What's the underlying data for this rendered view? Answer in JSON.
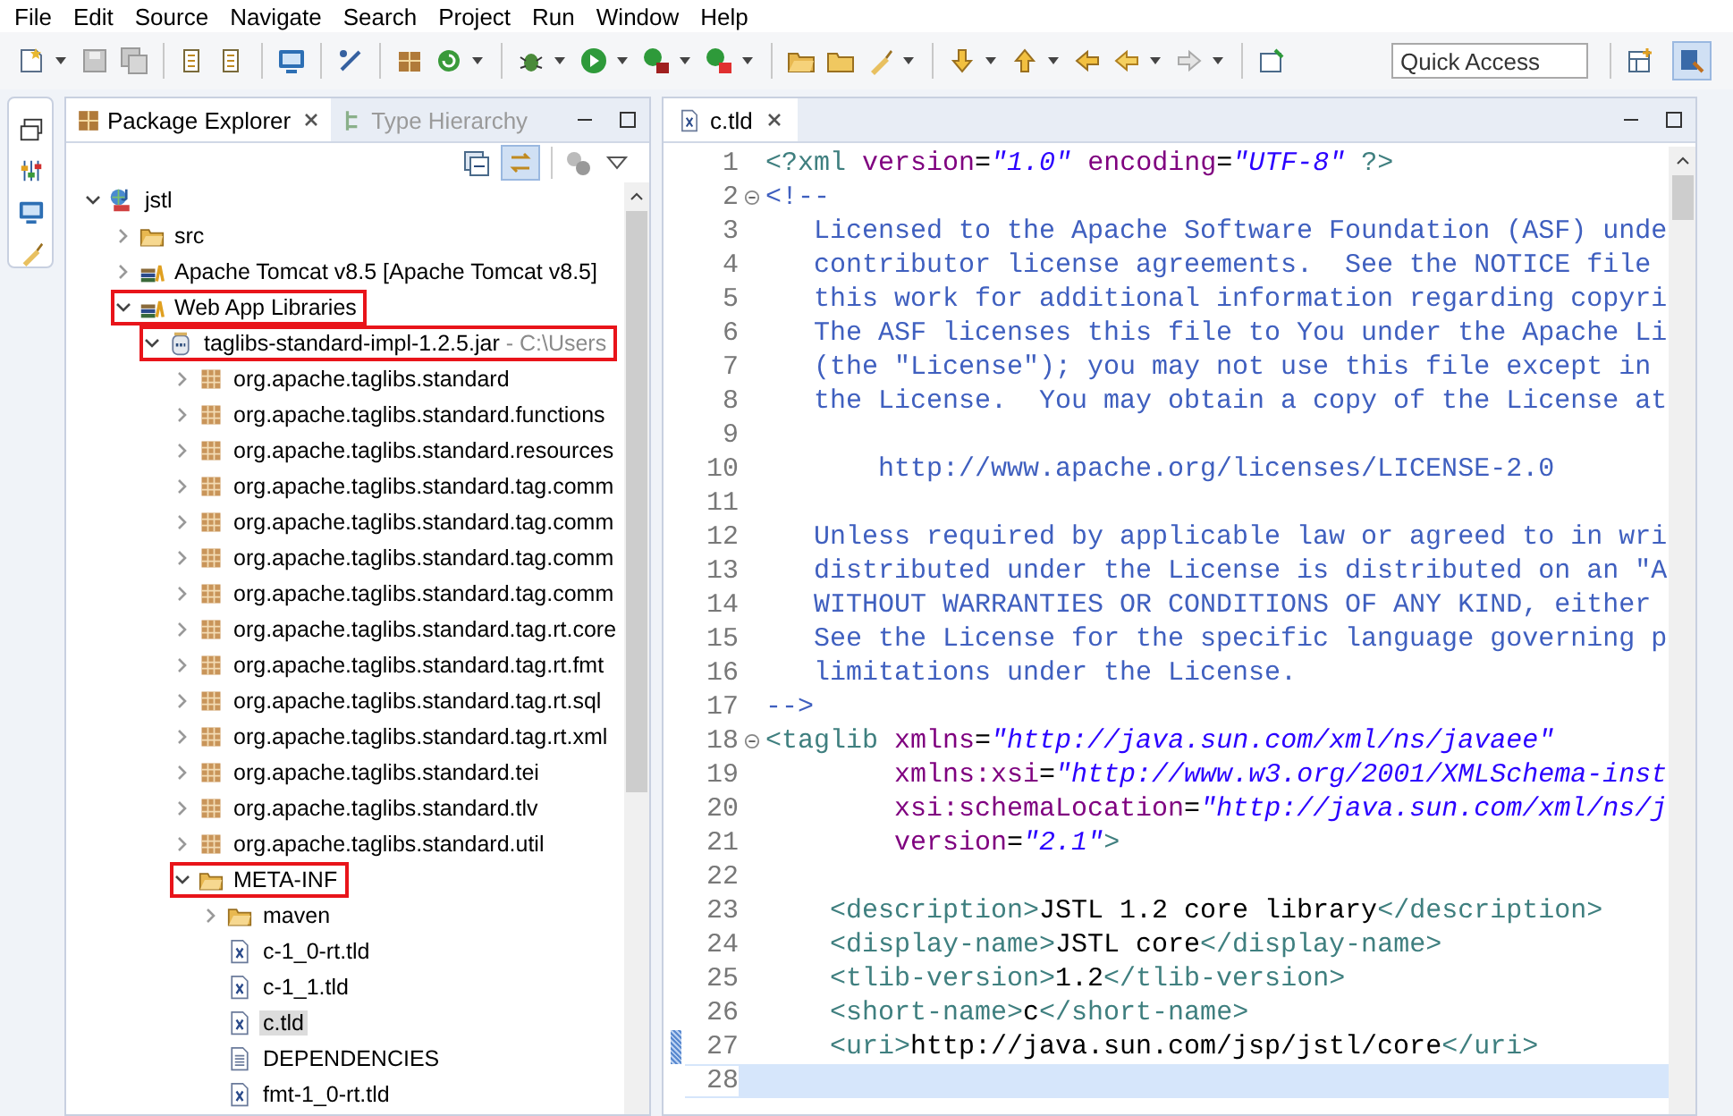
{
  "menu": [
    "File",
    "Edit",
    "Source",
    "Navigate",
    "Search",
    "Project",
    "Run",
    "Window",
    "Help"
  ],
  "quick_access": {
    "placeholder": "Quick Access"
  },
  "explorer": {
    "tabs": [
      {
        "label": "Package Explorer",
        "selected": true
      },
      {
        "label": "Type Hierarchy",
        "selected": false
      }
    ],
    "tree": [
      {
        "label": "jstl",
        "kind": "project",
        "expandable": true,
        "expanded": true,
        "highlighted": false,
        "selected": false,
        "children": [
          {
            "label": "src",
            "kind": "folder",
            "expandable": true,
            "expanded": false,
            "highlighted": false,
            "selected": false
          },
          {
            "label": "Apache Tomcat v8.5 [Apache Tomcat v8.5]",
            "kind": "library",
            "expandable": true,
            "expanded": false,
            "highlighted": false,
            "selected": false
          },
          {
            "label": "Web App Libraries",
            "kind": "library",
            "expandable": true,
            "expanded": true,
            "highlighted": true,
            "selected": false,
            "children": [
              {
                "label": "taglibs-standard-impl-1.2.5.jar",
                "location": " - C:\\Users",
                "kind": "jar",
                "expandable": true,
                "expanded": true,
                "highlighted": true,
                "selected": false,
                "children": [
                  {
                    "label": "org.apache.taglibs.standard",
                    "kind": "package",
                    "expandable": true,
                    "expanded": false,
                    "highlighted": false,
                    "selected": false
                  },
                  {
                    "label": "org.apache.taglibs.standard.functions",
                    "kind": "package",
                    "expandable": true,
                    "expanded": false,
                    "highlighted": false,
                    "selected": false
                  },
                  {
                    "label": "org.apache.taglibs.standard.resources",
                    "kind": "package",
                    "expandable": true,
                    "expanded": false,
                    "highlighted": false,
                    "selected": false
                  },
                  {
                    "label": "org.apache.taglibs.standard.tag.comm",
                    "kind": "package",
                    "expandable": true,
                    "expanded": false,
                    "highlighted": false,
                    "selected": false
                  },
                  {
                    "label": "org.apache.taglibs.standard.tag.comm",
                    "kind": "package",
                    "expandable": true,
                    "expanded": false,
                    "highlighted": false,
                    "selected": false
                  },
                  {
                    "label": "org.apache.taglibs.standard.tag.comm",
                    "kind": "package",
                    "expandable": true,
                    "expanded": false,
                    "highlighted": false,
                    "selected": false
                  },
                  {
                    "label": "org.apache.taglibs.standard.tag.comm",
                    "kind": "package",
                    "expandable": true,
                    "expanded": false,
                    "highlighted": false,
                    "selected": false
                  },
                  {
                    "label": "org.apache.taglibs.standard.tag.rt.core",
                    "kind": "package",
                    "expandable": true,
                    "expanded": false,
                    "highlighted": false,
                    "selected": false
                  },
                  {
                    "label": "org.apache.taglibs.standard.tag.rt.fmt",
                    "kind": "package",
                    "expandable": true,
                    "expanded": false,
                    "highlighted": false,
                    "selected": false
                  },
                  {
                    "label": "org.apache.taglibs.standard.tag.rt.sql",
                    "kind": "package",
                    "expandable": true,
                    "expanded": false,
                    "highlighted": false,
                    "selected": false
                  },
                  {
                    "label": "org.apache.taglibs.standard.tag.rt.xml",
                    "kind": "package",
                    "expandable": true,
                    "expanded": false,
                    "highlighted": false,
                    "selected": false
                  },
                  {
                    "label": "org.apache.taglibs.standard.tei",
                    "kind": "package",
                    "expandable": true,
                    "expanded": false,
                    "highlighted": false,
                    "selected": false
                  },
                  {
                    "label": "org.apache.taglibs.standard.tlv",
                    "kind": "package",
                    "expandable": true,
                    "expanded": false,
                    "highlighted": false,
                    "selected": false
                  },
                  {
                    "label": "org.apache.taglibs.standard.util",
                    "kind": "package",
                    "expandable": true,
                    "expanded": false,
                    "highlighted": false,
                    "selected": false
                  },
                  {
                    "label": "META-INF",
                    "kind": "folder",
                    "expandable": true,
                    "expanded": true,
                    "highlighted": true,
                    "selected": false,
                    "children": [
                      {
                        "label": "maven",
                        "kind": "folder",
                        "expandable": true,
                        "expanded": false,
                        "highlighted": false,
                        "selected": false
                      },
                      {
                        "label": "c-1_0-rt.tld",
                        "kind": "xml-file",
                        "expandable": false,
                        "highlighted": false,
                        "selected": false
                      },
                      {
                        "label": "c-1_1.tld",
                        "kind": "xml-file",
                        "expandable": false,
                        "highlighted": false,
                        "selected": false
                      },
                      {
                        "label": "c.tld",
                        "kind": "xml-file",
                        "expandable": false,
                        "highlighted": false,
                        "selected": true
                      },
                      {
                        "label": "DEPENDENCIES",
                        "kind": "text-file",
                        "expandable": false,
                        "highlighted": false,
                        "selected": false
                      },
                      {
                        "label": "fmt-1_0-rt.tld",
                        "kind": "xml-file",
                        "expandable": false,
                        "highlighted": false,
                        "selected": false
                      }
                    ]
                  }
                ]
              }
            ]
          }
        ]
      }
    ]
  },
  "editor": {
    "tab": "c.tld",
    "lines": [
      {
        "number": "1",
        "fold": false,
        "current": false,
        "marked": false,
        "tokens": [
          {
            "kind": "tag",
            "text": "<?xml "
          },
          {
            "kind": "attr",
            "text": "version"
          },
          {
            "kind": "punct",
            "text": "="
          },
          {
            "kind": "value",
            "text": "\"1.0\""
          },
          {
            "kind": "attr",
            "text": " encoding"
          },
          {
            "kind": "punct",
            "text": "="
          },
          {
            "kind": "value",
            "text": "\"UTF-8\""
          },
          {
            "kind": "tag",
            "text": " ?>"
          }
        ]
      },
      {
        "number": "2",
        "fold": true,
        "current": false,
        "marked": false,
        "tokens": [
          {
            "kind": "comment",
            "text": "<!--"
          }
        ]
      },
      {
        "number": "3",
        "fold": false,
        "current": false,
        "marked": false,
        "tokens": [
          {
            "kind": "comment",
            "text": "   Licensed to the Apache Software Foundation (ASF) unde"
          }
        ]
      },
      {
        "number": "4",
        "fold": false,
        "current": false,
        "marked": false,
        "tokens": [
          {
            "kind": "comment",
            "text": "   contributor license agreements.  See the NOTICE file"
          }
        ]
      },
      {
        "number": "5",
        "fold": false,
        "current": false,
        "marked": false,
        "tokens": [
          {
            "kind": "comment",
            "text": "   this work for additional information regarding copyri"
          }
        ]
      },
      {
        "number": "6",
        "fold": false,
        "current": false,
        "marked": false,
        "tokens": [
          {
            "kind": "comment",
            "text": "   The ASF licenses this file to You under the Apache Li"
          }
        ]
      },
      {
        "number": "7",
        "fold": false,
        "current": false,
        "marked": false,
        "tokens": [
          {
            "kind": "comment",
            "text": "   (the \"License\"); you may not use this file except in"
          }
        ]
      },
      {
        "number": "8",
        "fold": false,
        "current": false,
        "marked": false,
        "tokens": [
          {
            "kind": "comment",
            "text": "   the License.  You may obtain a copy of the License at"
          }
        ]
      },
      {
        "number": "9",
        "fold": false,
        "current": false,
        "marked": false
      },
      {
        "number": "10",
        "fold": false,
        "current": false,
        "marked": false,
        "tokens": [
          {
            "kind": "comment",
            "text": "       http://www.apache.org/licenses/LICENSE-2.0"
          }
        ]
      },
      {
        "number": "11",
        "fold": false,
        "current": false,
        "marked": false
      },
      {
        "number": "12",
        "fold": false,
        "current": false,
        "marked": false,
        "tokens": [
          {
            "kind": "comment",
            "text": "   Unless required by applicable law or agreed to in wri"
          }
        ]
      },
      {
        "number": "13",
        "fold": false,
        "current": false,
        "marked": false,
        "tokens": [
          {
            "kind": "comment",
            "text": "   distributed under the License is distributed on an \"A"
          }
        ]
      },
      {
        "number": "14",
        "fold": false,
        "current": false,
        "marked": false,
        "tokens": [
          {
            "kind": "comment",
            "text": "   WITHOUT WARRANTIES OR CONDITIONS OF ANY KIND, either"
          }
        ]
      },
      {
        "number": "15",
        "fold": false,
        "current": false,
        "marked": false,
        "tokens": [
          {
            "kind": "comment",
            "text": "   See the License for the specific language governing p"
          }
        ]
      },
      {
        "number": "16",
        "fold": false,
        "current": false,
        "marked": false,
        "tokens": [
          {
            "kind": "comment",
            "text": "   limitations under the License."
          }
        ]
      },
      {
        "number": "17",
        "fold": false,
        "current": false,
        "marked": false,
        "tokens": [
          {
            "kind": "comment",
            "text": "-->"
          }
        ]
      },
      {
        "number": "18",
        "fold": true,
        "current": false,
        "marked": false,
        "tokens": [
          {
            "kind": "tag",
            "text": "<taglib"
          },
          {
            "kind": "attr",
            "text": " xmlns"
          },
          {
            "kind": "punct",
            "text": "="
          },
          {
            "kind": "value",
            "text": "\"http://java.sun.com/xml/ns/javaee\""
          }
        ]
      },
      {
        "number": "19",
        "fold": false,
        "current": false,
        "marked": false,
        "tokens": [
          {
            "kind": "attr",
            "text": "        xmlns:xsi"
          },
          {
            "kind": "punct",
            "text": "="
          },
          {
            "kind": "value",
            "text": "\"http://www.w3.org/2001/XMLSchema-inst"
          }
        ]
      },
      {
        "number": "20",
        "fold": false,
        "current": false,
        "marked": false,
        "tokens": [
          {
            "kind": "attr",
            "text": "        xsi:schemaLocation"
          },
          {
            "kind": "punct",
            "text": "="
          },
          {
            "kind": "value",
            "text": "\"http://java.sun.com/xml/ns/j"
          }
        ]
      },
      {
        "number": "21",
        "fold": false,
        "current": false,
        "marked": false,
        "tokens": [
          {
            "kind": "attr",
            "text": "        version"
          },
          {
            "kind": "punct",
            "text": "="
          },
          {
            "kind": "value",
            "text": "\"2.1\""
          },
          {
            "kind": "tag",
            "text": ">"
          }
        ]
      },
      {
        "number": "22",
        "fold": false,
        "current": false,
        "marked": false
      },
      {
        "number": "23",
        "fold": false,
        "current": false,
        "marked": false,
        "tokens": [
          {
            "kind": "tag",
            "text": "    <description>"
          },
          {
            "kind": "punct",
            "text": "JSTL 1.2 core library"
          },
          {
            "kind": "tag",
            "text": "</description>"
          }
        ]
      },
      {
        "number": "24",
        "fold": false,
        "current": false,
        "marked": false,
        "tokens": [
          {
            "kind": "tag",
            "text": "    <display-name>"
          },
          {
            "kind": "punct",
            "text": "JSTL core"
          },
          {
            "kind": "tag",
            "text": "</display-name>"
          }
        ]
      },
      {
        "number": "25",
        "fold": false,
        "current": false,
        "marked": false,
        "tokens": [
          {
            "kind": "tag",
            "text": "    <tlib-version>"
          },
          {
            "kind": "punct",
            "text": "1.2"
          },
          {
            "kind": "tag",
            "text": "</tlib-version>"
          }
        ]
      },
      {
        "number": "26",
        "fold": false,
        "current": false,
        "marked": false,
        "tokens": [
          {
            "kind": "tag",
            "text": "    <short-name>"
          },
          {
            "kind": "punct",
            "text": "c"
          },
          {
            "kind": "tag",
            "text": "</short-name>"
          }
        ]
      },
      {
        "number": "27",
        "fold": false,
        "current": false,
        "marked": true,
        "tokens": [
          {
            "kind": "tag",
            "text": "    <uri>"
          },
          {
            "kind": "punct",
            "text": "http://java.sun.com/jsp/jstl/core"
          },
          {
            "kind": "tag",
            "text": "</uri>"
          }
        ]
      },
      {
        "number": "28",
        "fold": false,
        "current": true,
        "marked": false
      }
    ]
  }
}
